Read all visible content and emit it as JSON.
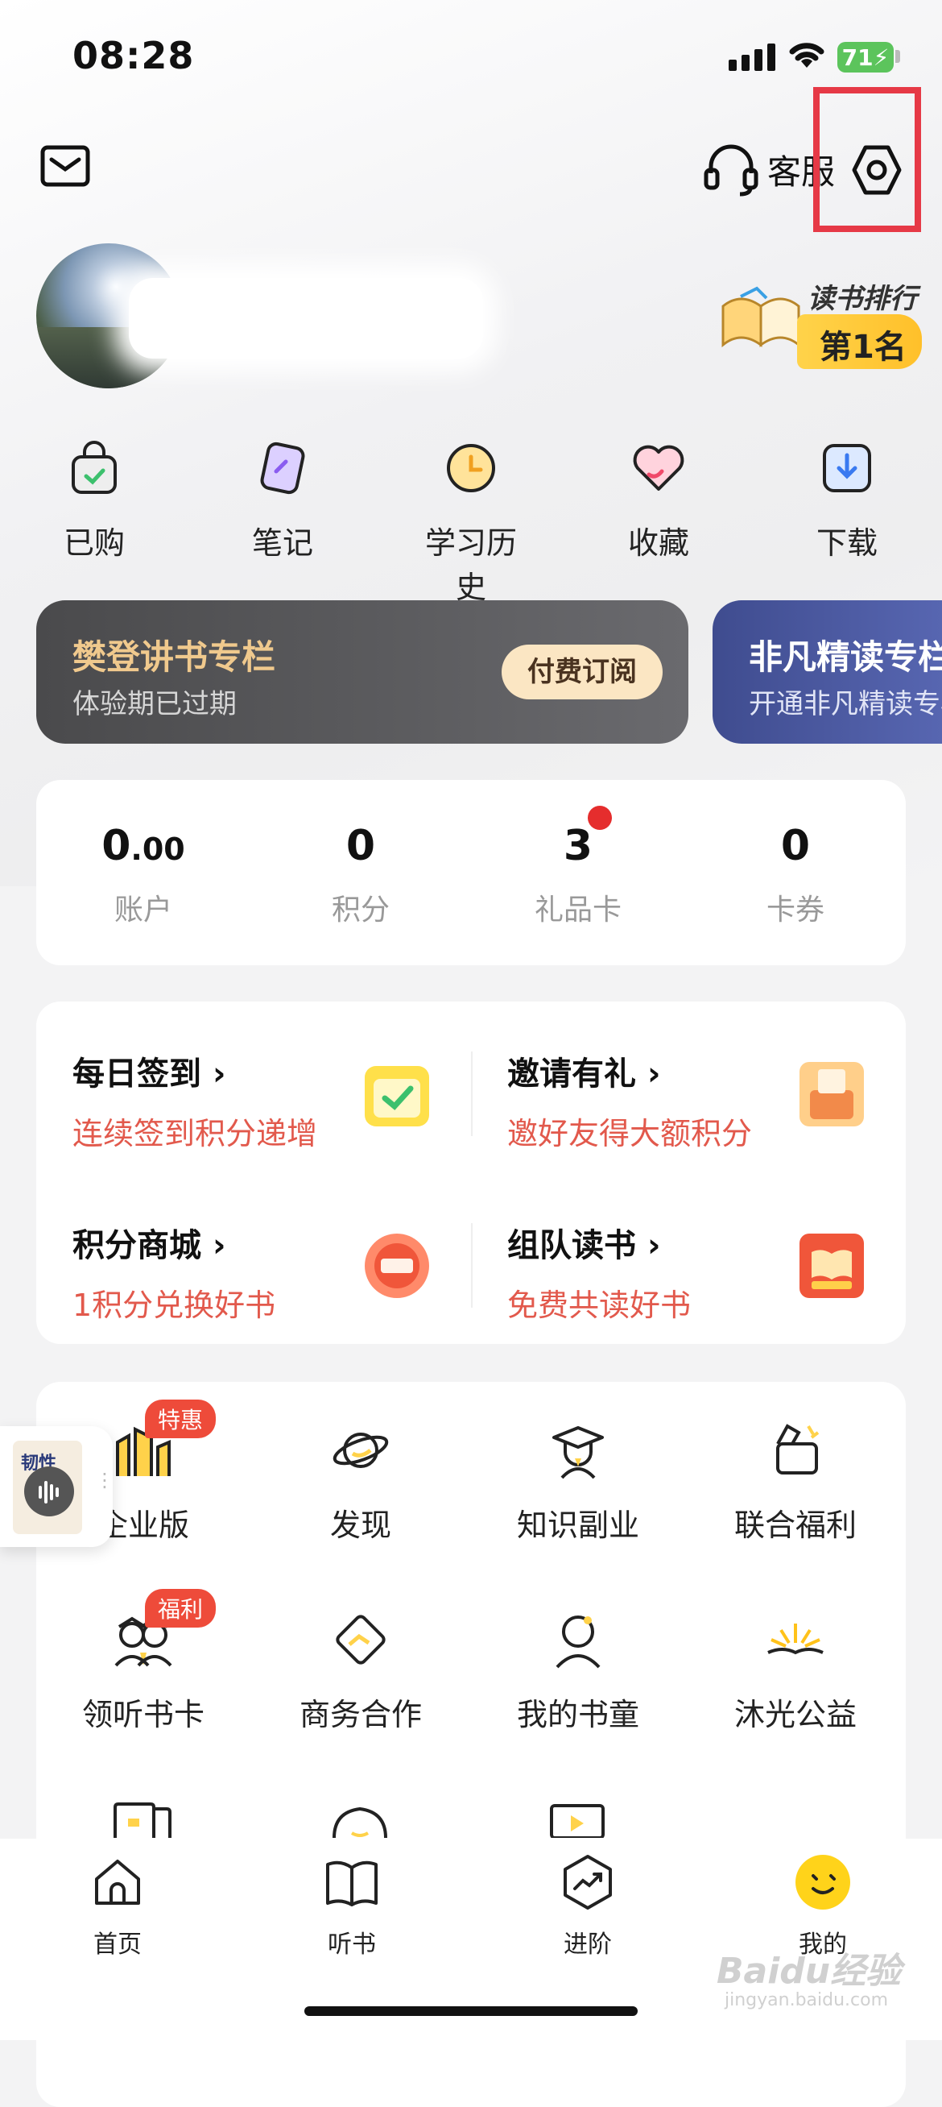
{
  "status_bar": {
    "time": "08:28",
    "battery": "71"
  },
  "header": {
    "service_label": "客服"
  },
  "rank": {
    "title": "读书排行榜",
    "value": "第1名"
  },
  "quick_actions": [
    {
      "label": "已购",
      "icon": "shopping-bag-icon"
    },
    {
      "label": "笔记",
      "icon": "note-icon"
    },
    {
      "label": "学习历史",
      "icon": "clock-icon"
    },
    {
      "label": "收藏",
      "icon": "heart-icon"
    },
    {
      "label": "下载",
      "icon": "download-icon"
    }
  ],
  "membership": {
    "dark": {
      "title": "樊登讲书专栏",
      "subtitle": "体验期已过期",
      "button": "付费订阅"
    },
    "blue": {
      "title": "非凡精读专栏",
      "subtitle": "开通非凡精读专栏"
    }
  },
  "stats": [
    {
      "value": "0",
      "decimal": ".00",
      "label": "账户"
    },
    {
      "value": "0",
      "decimal": "",
      "label": "积分"
    },
    {
      "value": "3",
      "decimal": "",
      "label": "礼品卡"
    },
    {
      "value": "0",
      "decimal": "",
      "label": "卡券"
    }
  ],
  "tasks": [
    {
      "title": "每日签到",
      "subtitle": "连续签到积分递增",
      "icon": "calendar-check-icon"
    },
    {
      "title": "邀请有礼",
      "subtitle": "邀好友得大额积分",
      "icon": "gift-invite-icon"
    },
    {
      "title": "积分商城",
      "subtitle": "1积分兑换好书",
      "icon": "mall-icon"
    },
    {
      "title": "组队读书",
      "subtitle": "免费共读好书",
      "icon": "team-book-icon"
    }
  ],
  "services": [
    {
      "label": "企业版",
      "badge": "特惠",
      "icon": "enterprise-icon"
    },
    {
      "label": "发现",
      "badge": "",
      "icon": "planet-icon"
    },
    {
      "label": "知识副业",
      "badge": "",
      "icon": "graduate-icon"
    },
    {
      "label": "联合福利",
      "badge": "",
      "icon": "coupon-icon"
    },
    {
      "label": "领听书卡",
      "badge": "福利",
      "icon": "card-people-icon"
    },
    {
      "label": "商务合作",
      "badge": "",
      "icon": "handshake-icon"
    },
    {
      "label": "我的书童",
      "badge": "",
      "icon": "assistant-icon"
    },
    {
      "label": "沐光公益",
      "badge": "",
      "icon": "sunrise-book-icon"
    }
  ],
  "floating_player": {
    "book_title": "韧性"
  },
  "tabs": [
    {
      "label": "首页",
      "icon": "home-icon"
    },
    {
      "label": "听书",
      "icon": "book-open-icon"
    },
    {
      "label": "进阶",
      "icon": "trend-hexagon-icon"
    },
    {
      "label": "我的",
      "icon": "smile-face-icon"
    }
  ],
  "watermark": {
    "main": "Baidu经验",
    "sub": "jingyan.baidu.com"
  }
}
